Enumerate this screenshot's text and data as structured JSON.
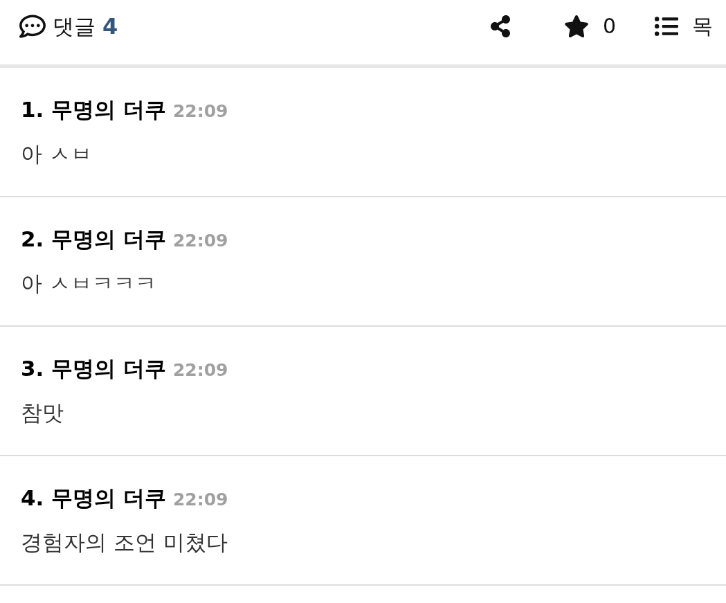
{
  "header": {
    "comments_label": "댓글",
    "comment_count": "4",
    "star_count": "0",
    "list_label": "목"
  },
  "comments": [
    {
      "title": "1. 무명의 더쿠",
      "time": "22:09",
      "text": "아 ㅅㅂ"
    },
    {
      "title": "2. 무명의 더쿠",
      "time": "22:09",
      "text": "아 ㅅㅂㅋㅋㅋ"
    },
    {
      "title": "3. 무명의 더쿠",
      "time": "22:09",
      "text": "참맛"
    },
    {
      "title": "4. 무명의 더쿠",
      "time": "22:09",
      "text": "경험자의 조언 미쳤다"
    }
  ]
}
